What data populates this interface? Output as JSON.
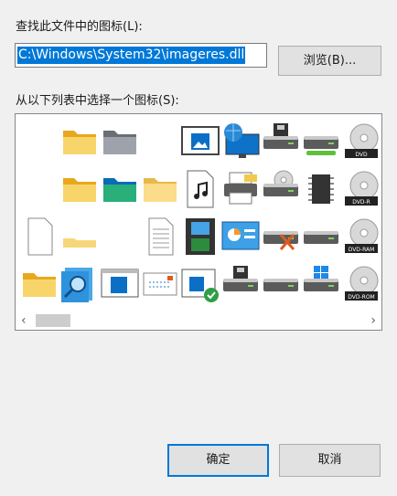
{
  "dialog": {
    "file_label": "查找此文件中的图标(L):",
    "file_path": "C:\\Windows\\System32\\imageres.dll",
    "browse_label": "浏览(B)...",
    "list_label": "从以下列表中选择一个图标(S):",
    "ok_label": "确定",
    "cancel_label": "取消"
  },
  "icons": [
    {
      "name": "blank-icon",
      "label": ""
    },
    {
      "name": "folder-icon",
      "label": ""
    },
    {
      "name": "folder-gray-icon",
      "label": ""
    },
    {
      "name": "blank-icon",
      "label": ""
    },
    {
      "name": "picture-window-icon",
      "label": ""
    },
    {
      "name": "globe-monitor-icon",
      "label": ""
    },
    {
      "name": "floppy-drive-icon",
      "label": ""
    },
    {
      "name": "usb-drive-icon",
      "label": ""
    },
    {
      "name": "dvd-drive-icon",
      "label": "DVD"
    },
    {
      "name": "blank-icon",
      "label": ""
    },
    {
      "name": "folder-icon",
      "label": ""
    },
    {
      "name": "folder-color-icon",
      "label": ""
    },
    {
      "name": "folder-light-icon",
      "label": ""
    },
    {
      "name": "music-file-icon",
      "label": ""
    },
    {
      "name": "printer-icon",
      "label": ""
    },
    {
      "name": "cd-drive-icon",
      "label": ""
    },
    {
      "name": "chip-icon",
      "label": ""
    },
    {
      "name": "dvd-r-icon",
      "label": "DVD-R"
    },
    {
      "name": "blank-file-icon",
      "label": ""
    },
    {
      "name": "flat-folder-icon",
      "label": ""
    },
    {
      "name": "blank-icon",
      "label": ""
    },
    {
      "name": "text-file-icon",
      "label": ""
    },
    {
      "name": "film-icon",
      "label": ""
    },
    {
      "name": "control-panel-icon",
      "label": ""
    },
    {
      "name": "network-drive-disconnected-icon",
      "label": ""
    },
    {
      "name": "drive-icon",
      "label": ""
    },
    {
      "name": "dvd-ram-icon",
      "label": "DVD-RAM"
    },
    {
      "name": "folder-icon",
      "label": ""
    },
    {
      "name": "search-folder-icon",
      "label": ""
    },
    {
      "name": "window-app-icon",
      "label": ""
    },
    {
      "name": "mail-icon",
      "label": ""
    },
    {
      "name": "verified-window-icon",
      "label": ""
    },
    {
      "name": "floppy-drive-icon",
      "label": ""
    },
    {
      "name": "drive-icon",
      "label": ""
    },
    {
      "name": "windows-drive-icon",
      "label": ""
    },
    {
      "name": "dvd-rom-icon",
      "label": "DVD-ROM"
    }
  ]
}
